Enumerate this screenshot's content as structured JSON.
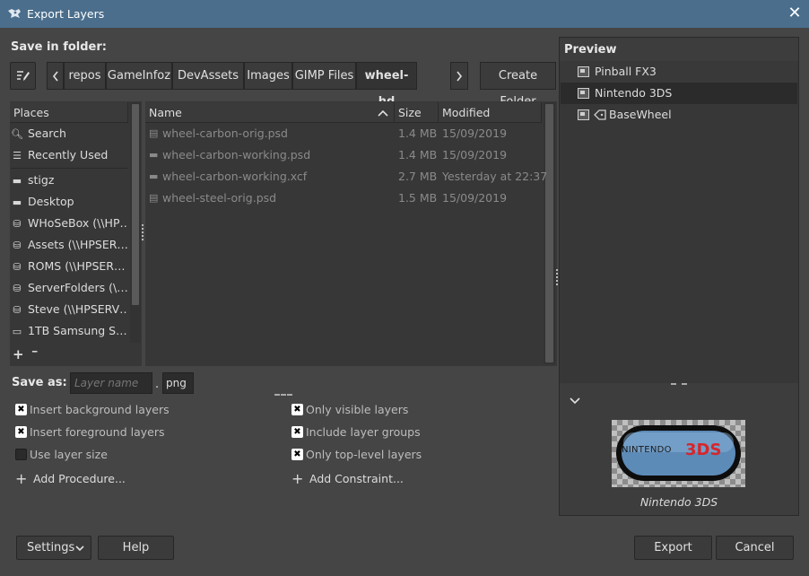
{
  "window": {
    "title": "Export Layers",
    "close_glyph": "✕"
  },
  "save_in_folder_label": "Save in folder:",
  "path_bar": {
    "segments": [
      "repos",
      "GameInfoz",
      "DevAssets",
      "Images",
      "GIMP Files",
      "wheel-hd"
    ],
    "create_folder_label": "Create Folder"
  },
  "places": {
    "header": "Places",
    "items": [
      {
        "label": "Search",
        "icon": "search-icon"
      },
      {
        "label": "Recently Used",
        "icon": "recent-icon"
      },
      {
        "label": "stigz",
        "icon": "folder-icon"
      },
      {
        "label": "Desktop",
        "icon": "folder-icon"
      },
      {
        "label": "WHoSeBox (\\\\HP…",
        "icon": "network-drive-icon"
      },
      {
        "label": "Assets (\\\\HPSER…",
        "icon": "network-drive-icon"
      },
      {
        "label": "ROMS (\\\\HPSER…",
        "icon": "network-drive-icon"
      },
      {
        "label": "ServerFolders (\\…",
        "icon": "network-drive-icon"
      },
      {
        "label": "Steve (\\\\HPSERV…",
        "icon": "network-drive-icon"
      },
      {
        "label": "1TB Samsung S…",
        "icon": "drive-icon"
      }
    ],
    "add_glyph": "+",
    "remove_glyph": "━"
  },
  "files": {
    "columns": {
      "name": "Name",
      "size": "Size",
      "modified": "Modified"
    },
    "rows": [
      {
        "name": "wheel-carbon-orig.psd",
        "size": "1.4 MB",
        "modified": "15/09/2019",
        "icon": "image-file-icon"
      },
      {
        "name": "wheel-carbon-working.psd",
        "size": "1.4 MB",
        "modified": "15/09/2019",
        "icon": "image-file-icon"
      },
      {
        "name": "wheel-carbon-working.xcf",
        "size": "2.7 MB",
        "modified": "Yesterday at 22:37",
        "icon": "image-file-icon"
      },
      {
        "name": "wheel-steel-orig.psd",
        "size": "1.5 MB",
        "modified": "15/09/2019",
        "icon": "image-file-icon"
      }
    ]
  },
  "save_as": {
    "label": "Save as:",
    "name_placeholder": "Layer name",
    "dot": ".",
    "extension": "png"
  },
  "options": {
    "left": [
      {
        "label": "Insert background layers",
        "checked": true
      },
      {
        "label": "Insert foreground layers",
        "checked": true
      },
      {
        "label": "Use layer size",
        "checked": false
      }
    ],
    "right": [
      {
        "label": "Only visible layers",
        "checked": true
      },
      {
        "label": "Include layer groups",
        "checked": true
      },
      {
        "label": "Only top-level layers",
        "checked": true
      }
    ],
    "add_procedure": "Add Procedure...",
    "add_constraint": "Add Constraint...",
    "check_glyph": "✖"
  },
  "preview": {
    "header": "Preview",
    "layers": [
      "Pinball FX3",
      "Nintendo 3DS",
      "BaseWheel"
    ],
    "selected_layer": "Nintendo 3DS",
    "thumbnail_text_a": "NINTENDO",
    "thumbnail_text_b": "3DS",
    "caption": "Nintendo 3DS",
    "collapse_glyph": "⌄"
  },
  "footer": {
    "settings_label": "Settings",
    "help_label": "Help",
    "export_label": "Export",
    "cancel_label": "Cancel"
  },
  "colors": {
    "titlebar": "#4a6e8c",
    "dialog_bg": "#454545",
    "panel_bg": "#373737",
    "selected_row": "#2b2b2b",
    "logo_red": "#d6262b",
    "logo_blue": "#5d8bb8"
  }
}
